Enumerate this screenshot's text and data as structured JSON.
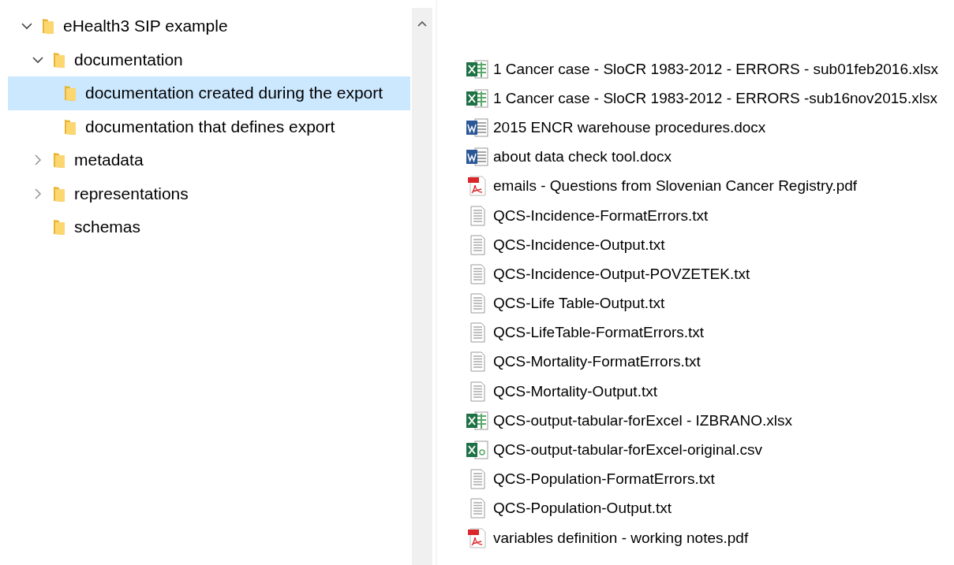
{
  "tree": [
    {
      "label": "eHealth3 SIP example",
      "expanded": true,
      "selected": false,
      "children": [
        {
          "label": "documentation",
          "expanded": true,
          "selected": false,
          "children": [
            {
              "label": "documentation created during the export",
              "selected": true
            },
            {
              "label": "documentation that defines export",
              "selected": false
            }
          ]
        },
        {
          "label": "metadata",
          "expanded": false,
          "selected": false
        },
        {
          "label": "representations",
          "expanded": false,
          "selected": false
        },
        {
          "label": "schemas",
          "selected": false
        }
      ]
    }
  ],
  "files": [
    {
      "name": "1 Cancer case - SloCR 1983-2012 - ERRORS - sub01feb2016.xlsx",
      "kind": "excel"
    },
    {
      "name": "1 Cancer case - SloCR 1983-2012 - ERRORS -sub16nov2015.xlsx",
      "kind": "excel"
    },
    {
      "name": "2015 ENCR warehouse procedures.docx",
      "kind": "word"
    },
    {
      "name": "about data check tool.docx",
      "kind": "word"
    },
    {
      "name": "emails - Questions from Slovenian Cancer Registry.pdf",
      "kind": "pdf"
    },
    {
      "name": "QCS-Incidence-FormatErrors.txt",
      "kind": "text"
    },
    {
      "name": "QCS-Incidence-Output.txt",
      "kind": "text"
    },
    {
      "name": "QCS-Incidence-Output-POVZETEK.txt",
      "kind": "text"
    },
    {
      "name": "QCS-Life Table-Output.txt",
      "kind": "text"
    },
    {
      "name": "QCS-LifeTable-FormatErrors.txt",
      "kind": "text"
    },
    {
      "name": "QCS-Mortality-FormatErrors.txt",
      "kind": "text"
    },
    {
      "name": "QCS-Mortality-Output.txt",
      "kind": "text"
    },
    {
      "name": "QCS-output-tabular-forExcel - IZBRANO.xlsx",
      "kind": "excel"
    },
    {
      "name": "QCS-output-tabular-forExcel-original.csv",
      "kind": "csv"
    },
    {
      "name": "QCS-Population-FormatErrors.txt",
      "kind": "text"
    },
    {
      "name": "QCS-Population-Output.txt",
      "kind": "text"
    },
    {
      "name": "variables definition - working notes.pdf",
      "kind": "pdf"
    }
  ]
}
